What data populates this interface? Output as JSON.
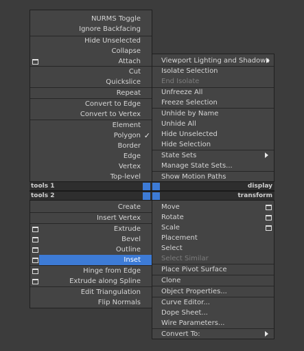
{
  "left_menu": {
    "items": [
      {
        "label": "NURMS Toggle"
      },
      {
        "label": "Ignore Backfacing"
      },
      {
        "label": "Hide Unselected"
      },
      {
        "label": "Collapse"
      },
      {
        "label": "Attach"
      },
      {
        "label": "Cut"
      },
      {
        "label": "Quickslice"
      },
      {
        "label": "Repeat"
      },
      {
        "label": "Convert to Edge"
      },
      {
        "label": "Convert to Vertex"
      },
      {
        "label": "Element"
      },
      {
        "label": "Polygon"
      },
      {
        "label": "Border"
      },
      {
        "label": "Edge"
      },
      {
        "label": "Vertex"
      },
      {
        "label": "Top-level"
      },
      {
        "label": "Create"
      },
      {
        "label": "Insert Vertex"
      },
      {
        "label": "Extrude"
      },
      {
        "label": "Bevel"
      },
      {
        "label": "Outline"
      },
      {
        "label": "Inset"
      },
      {
        "label": "Hinge from Edge"
      },
      {
        "label": "Extrude along Spline"
      },
      {
        "label": "Edit Triangulation"
      },
      {
        "label": "Flip Normals"
      }
    ],
    "check_glyph": "✓"
  },
  "quad_headers": {
    "tools1": "tools 1",
    "display": "display",
    "tools2": "tools 2",
    "transform": "transform"
  },
  "right_menu": {
    "items": [
      {
        "label": "Viewport Lighting and Shadows"
      },
      {
        "label": "Isolate Selection"
      },
      {
        "label": "End Isolate"
      },
      {
        "label": "Unfreeze All"
      },
      {
        "label": "Freeze Selection"
      },
      {
        "label": "Unhide by Name"
      },
      {
        "label": "Unhide All"
      },
      {
        "label": "Hide Unselected"
      },
      {
        "label": "Hide Selection"
      },
      {
        "label": "State Sets"
      },
      {
        "label": "Manage State Sets..."
      },
      {
        "label": "Show Motion Paths"
      },
      {
        "label": "Move"
      },
      {
        "label": "Rotate"
      },
      {
        "label": "Scale"
      },
      {
        "label": "Placement"
      },
      {
        "label": "Select"
      },
      {
        "label": "Select Similar"
      },
      {
        "label": "Place Pivot Surface"
      },
      {
        "label": "Clone"
      },
      {
        "label": "Object Properties..."
      },
      {
        "label": "Curve Editor..."
      },
      {
        "label": "Dope Sheet..."
      },
      {
        "label": "Wire Parameters..."
      },
      {
        "label": "Convert To:"
      }
    ]
  },
  "colors": {
    "menu_bg": "#444444",
    "selected": "#3d7bd6",
    "header_bg": "#2e2e2e",
    "disabled_text": "#7d7d7d"
  }
}
